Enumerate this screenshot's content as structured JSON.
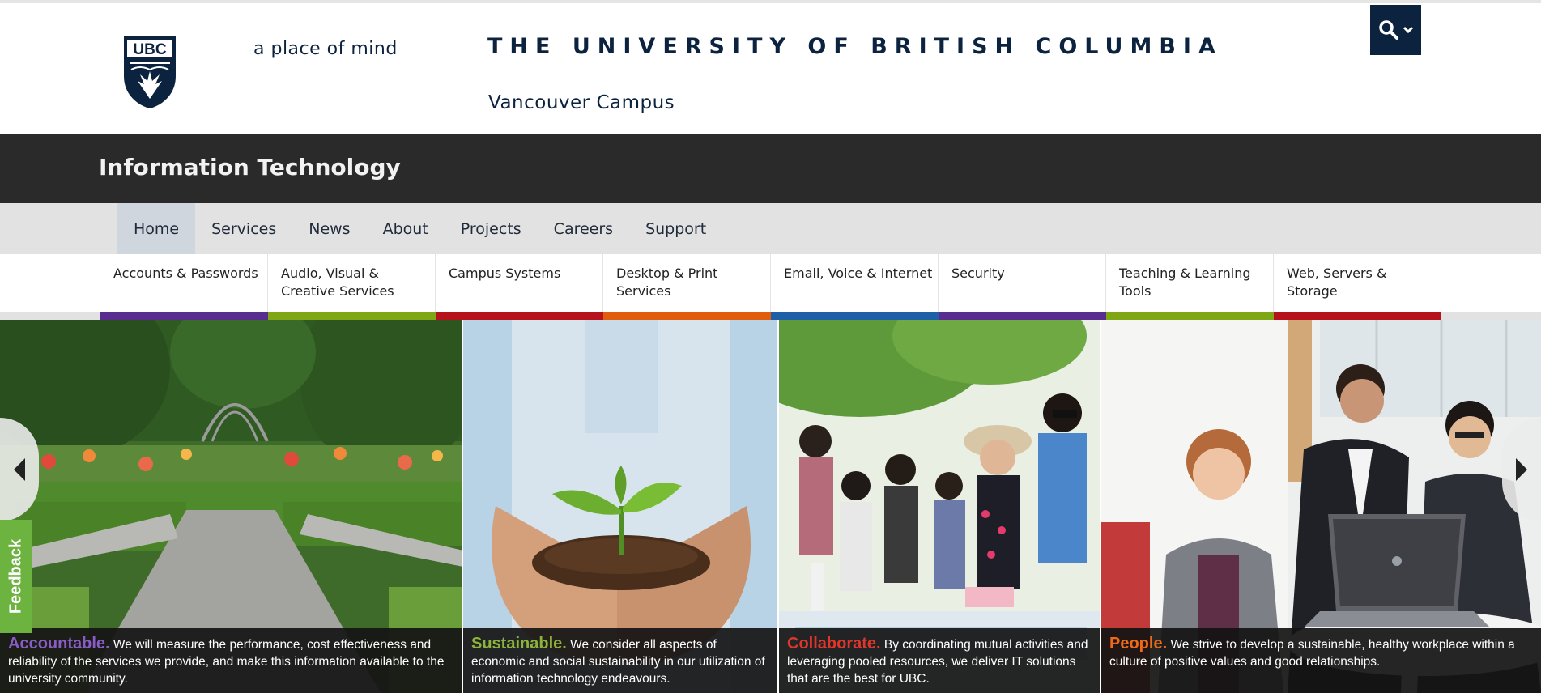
{
  "header": {
    "crest_text": "UBC",
    "tagline": "a place of mind",
    "university": "THE UNIVERSITY OF BRITISH COLUMBIA",
    "campus": "Vancouver Campus",
    "search_icon": "search-icon",
    "brand_color": "#0c2340"
  },
  "unit": {
    "name": "Information Technology"
  },
  "nav": {
    "items": [
      {
        "label": "Home",
        "active": true
      },
      {
        "label": "Services"
      },
      {
        "label": "News"
      },
      {
        "label": "About"
      },
      {
        "label": "Projects"
      },
      {
        "label": "Careers"
      },
      {
        "label": "Support"
      }
    ]
  },
  "subnav": {
    "items": [
      {
        "label": "Accounts & Passwords",
        "color": "#5b2c8f"
      },
      {
        "label": "Audio, Visual & Creative Services",
        "color": "#7fa614"
      },
      {
        "label": "Campus Systems",
        "color": "#b5121b"
      },
      {
        "label": "Desktop & Print Services",
        "color": "#e05d0e"
      },
      {
        "label": "Email, Voice & Internet",
        "color": "#1f5fa8"
      },
      {
        "label": "Security",
        "color": "#5b2c8f"
      },
      {
        "label": "Teaching & Learning Tools",
        "color": "#7fa614"
      },
      {
        "label": "Web, Servers & Storage",
        "color": "#b5121b"
      }
    ]
  },
  "slides": [
    {
      "lead": "Accountable.",
      "text": "We will measure the performance, cost effectiveness and reliability of the services we provide, and make this information available to the university community.",
      "lead_color": "#8a5cc7",
      "scene": "garden"
    },
    {
      "lead": "Sustainable.",
      "text": "We consider all aspects of economic and social sustainability in our utilization of information technology endeavours.",
      "lead_color": "#8db33a",
      "scene": "seedling"
    },
    {
      "lead": "Collaborate.",
      "text": "By coordinating mutual activities and leveraging pooled resources, we deliver IT solutions that are the best for UBC.",
      "lead_color": "#e0352b",
      "scene": "students"
    },
    {
      "lead": "People.",
      "text": "We strive to develop a sustainable, healthy workplace within a culture of positive values and good relationships.",
      "lead_color": "#ee6a16",
      "scene": "office"
    }
  ],
  "slider": {
    "prev_icon": "chevron-left-icon",
    "next_icon": "chevron-right-icon"
  },
  "feedback": {
    "label": "Feedback",
    "color": "#6cb33f"
  }
}
